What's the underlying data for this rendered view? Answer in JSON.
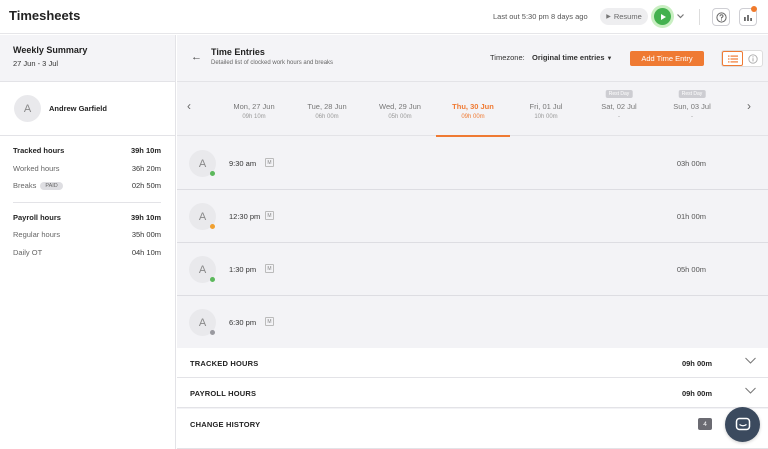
{
  "app": {
    "title": "Timesheets"
  },
  "topbar": {
    "last_out": "Last out 5:30 pm 8 days ago",
    "resume_label": "Resume"
  },
  "summary": {
    "title": "Weekly Summary",
    "range": "27 Jun - 3 Jul",
    "user_initial": "A",
    "user_name": "Andrew Garfield",
    "tracked": {
      "label": "Tracked hours",
      "value": "39h 10m"
    },
    "worked": {
      "label": "Worked hours",
      "value": "36h 20m"
    },
    "breaks": {
      "label": "Breaks",
      "badge": "PAID",
      "value": "02h 50m"
    },
    "payroll": {
      "label": "Payroll hours",
      "value": "39h 10m"
    },
    "regular": {
      "label": "Regular hours",
      "value": "35h 00m"
    },
    "daily_ot": {
      "label": "Daily OT",
      "value": "04h 10m"
    }
  },
  "entries_header": {
    "title": "Time Entries",
    "subtitle": "Detailed list of clocked work hours and breaks",
    "timezone_label": "Timezone:",
    "timezone_value": "Original time entries",
    "add_button": "Add Time Entry"
  },
  "days": [
    {
      "name": "Mon, 27 Jun",
      "hours": "09h 10m",
      "rest": ""
    },
    {
      "name": "Tue, 28 Jun",
      "hours": "06h 00m",
      "rest": ""
    },
    {
      "name": "Wed, 29 Jun",
      "hours": "05h 00m",
      "rest": ""
    },
    {
      "name": "Thu, 30 Jun",
      "hours": "09h 00m",
      "rest": "",
      "active": true
    },
    {
      "name": "Fri, 01 Jul",
      "hours": "10h 00m",
      "rest": ""
    },
    {
      "name": "Sat, 02 Jul",
      "hours": "-",
      "rest": "Rest Day"
    },
    {
      "name": "Sun, 03 Jul",
      "hours": "-",
      "rest": "Rest Day"
    }
  ],
  "entries": [
    {
      "initial": "A",
      "time": "9:30 am",
      "badge": "M",
      "duration": "03h 00m",
      "status_color": "#5cb85c"
    },
    {
      "initial": "A",
      "time": "12:30 pm",
      "badge": "M",
      "duration": "01h 00m",
      "status_color": "#f0a030"
    },
    {
      "initial": "A",
      "time": "1:30 pm",
      "badge": "M",
      "duration": "05h 00m",
      "status_color": "#5cb85c"
    },
    {
      "initial": "A",
      "time": "6:30 pm",
      "badge": "M",
      "duration": "",
      "status_color": "#9a9aa0"
    }
  ],
  "totals": {
    "tracked_label": "TRACKED HOURS",
    "tracked_value": "09h 00m",
    "payroll_label": "PAYROLL HOURS",
    "payroll_value": "09h 00m",
    "history_label": "CHANGE HISTORY",
    "history_count": "4"
  },
  "colors": {
    "accent": "#ef7a33",
    "play_green": "#43b14e",
    "chat_bg": "#3b4a5e"
  }
}
